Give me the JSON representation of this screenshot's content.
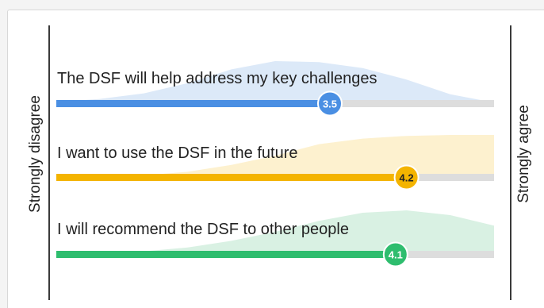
{
  "chart_data": {
    "type": "bar",
    "scale": {
      "min": 1,
      "max": 5
    },
    "left_axis_label": "Strongly disagree",
    "right_axis_label": "Strongly agree",
    "series": [
      {
        "name": "The DSF will help address my key challenges",
        "value": 3.5,
        "value_label": "3.5",
        "color": "#4a8fe3",
        "fill_color": "#dce9f8",
        "distribution": [
          0.12,
          0.18,
          0.3,
          0.52,
          0.82,
          1.0,
          0.98,
          0.85,
          0.6,
          0.28,
          0.1
        ]
      },
      {
        "name": "I want to use the DSF in the future",
        "value": 4.2,
        "value_label": "4.2",
        "color": "#f4b400",
        "fill_color": "#fdf1cf",
        "distribution": [
          0.1,
          0.1,
          0.12,
          0.2,
          0.35,
          0.55,
          0.8,
          0.92,
          0.98,
          1.0,
          1.0
        ]
      },
      {
        "name": "I will recommend the DSF to other people",
        "value": 4.1,
        "value_label": "4.1",
        "color": "#2ebd6e",
        "fill_color": "#d9f1e3",
        "distribution": [
          0.08,
          0.1,
          0.14,
          0.22,
          0.36,
          0.55,
          0.78,
          0.95,
          1.0,
          0.9,
          0.68
        ]
      }
    ]
  }
}
